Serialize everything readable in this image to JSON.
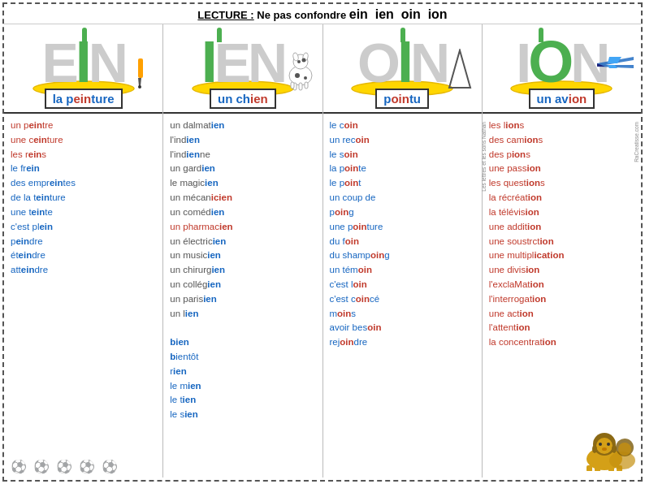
{
  "title": {
    "prefix": "LECTURE : Ne pas confondre ",
    "sounds": "ein  ien  oin  ion"
  },
  "columns": [
    {
      "id": "ein",
      "bigLetter1": "E",
      "bigLetter2": "N",
      "greenLetter": "I",
      "wordLabel": "la peinture",
      "wordLabelHighlight": "ein",
      "words": [
        {
          "text": "un peintre",
          "color": "red",
          "bold": "ein"
        },
        {
          "text": "une ceinture",
          "color": "red",
          "bold": "ein"
        },
        {
          "text": "les reins",
          "color": "red",
          "bold": "ein"
        },
        {
          "text": "le frein",
          "color": "blue",
          "bold": "ein"
        },
        {
          "text": "des empreintes",
          "color": "blue",
          "bold": "ein"
        },
        {
          "text": "de la teinture",
          "color": "blue",
          "bold": "ein"
        },
        {
          "text": "une teinte",
          "color": "blue",
          "bold": "ein"
        },
        {
          "text": "c'est plein",
          "color": "blue",
          "bold": "ein"
        },
        {
          "text": "peindre",
          "color": "blue",
          "bold": "ein"
        },
        {
          "text": "éteindre",
          "color": "blue",
          "bold": "ein"
        },
        {
          "text": "atteindre",
          "color": "blue",
          "bold": "ein"
        }
      ],
      "hasFooterIcons": true
    },
    {
      "id": "ien",
      "bigLetter1": "E",
      "bigLetter2": "N",
      "greenLetter": "I",
      "wordLabel": "un chien",
      "wordLabelHighlight": "ien",
      "words": [
        {
          "text": "un dalmatien",
          "color": "dark"
        },
        {
          "text": "l'indien",
          "color": "dark"
        },
        {
          "text": "l'indienne",
          "color": "dark"
        },
        {
          "text": "un gardien",
          "color": "dark"
        },
        {
          "text": "le magicien",
          "color": "dark"
        },
        {
          "text": "un mécanicien",
          "color": "dark"
        },
        {
          "text": "un comédien",
          "color": "dark"
        },
        {
          "text": "un pharmacien",
          "color": "dark"
        },
        {
          "text": "un électricien",
          "color": "dark"
        },
        {
          "text": "un musicien",
          "color": "dark"
        },
        {
          "text": "un chirurgien",
          "color": "dark"
        },
        {
          "text": "un collégien",
          "color": "dark"
        },
        {
          "text": "un parisien",
          "color": "dark"
        },
        {
          "text": "un lien",
          "color": "dark"
        },
        {
          "text": "",
          "color": "dark"
        },
        {
          "text": "bien",
          "color": "blue",
          "bold": "ien"
        },
        {
          "text": "bientôt",
          "color": "blue",
          "bold": "ien"
        },
        {
          "text": "rien",
          "color": "blue",
          "bold": "ien"
        },
        {
          "text": "le mien",
          "color": "blue",
          "bold": "ien"
        },
        {
          "text": "le tien",
          "color": "blue",
          "bold": "ien"
        },
        {
          "text": "le sien",
          "color": "blue",
          "bold": "ien"
        }
      ],
      "hasFooterIcons": false
    },
    {
      "id": "oin",
      "bigLetter1": "O",
      "bigLetter2": "N",
      "greenLetter": "I",
      "wordLabel": "pointu",
      "wordLabelHighlight": "oin",
      "words": [
        {
          "text": "le coin",
          "color": "blue",
          "bold": "oin"
        },
        {
          "text": "un recoin",
          "color": "blue",
          "bold": "oin"
        },
        {
          "text": "le soin",
          "color": "blue",
          "bold": "oin"
        },
        {
          "text": "la pointe",
          "color": "blue",
          "bold": "oin"
        },
        {
          "text": "le point",
          "color": "blue",
          "bold": "oin"
        },
        {
          "text": "un coup de",
          "color": "blue"
        },
        {
          "text": "poing",
          "color": "blue",
          "bold": "oing"
        },
        {
          "text": "une pointure",
          "color": "blue",
          "bold": "oin"
        },
        {
          "text": "du foin",
          "color": "blue",
          "bold": "oin"
        },
        {
          "text": "du shampoing",
          "color": "blue",
          "bold": "oin"
        },
        {
          "text": "un témoin",
          "color": "blue",
          "bold": "oin"
        },
        {
          "text": "c'est loin",
          "color": "blue",
          "bold": "oin"
        },
        {
          "text": "c'est coincé",
          "color": "blue",
          "bold": "oin"
        },
        {
          "text": "moins",
          "color": "blue",
          "bold": "oin"
        },
        {
          "text": "avoir besoin",
          "color": "blue",
          "bold": "oin"
        },
        {
          "text": "rejoindre",
          "color": "blue",
          "bold": "oin"
        }
      ],
      "hasFooterIcons": false
    },
    {
      "id": "ion",
      "bigLetter1": "O",
      "bigLetter2": "N",
      "greenLetter": "I",
      "wordLabel": "un avion",
      "wordLabelHighlight": "ion",
      "words": [
        {
          "text": "les lions",
          "color": "red",
          "bold": "ion"
        },
        {
          "text": "des camions",
          "color": "red",
          "bold": "ion"
        },
        {
          "text": "des pions",
          "color": "red",
          "bold": "ion"
        },
        {
          "text": "une passion",
          "color": "red",
          "bold": "ion"
        },
        {
          "text": "les questions",
          "color": "red",
          "bold": "ion"
        },
        {
          "text": "la récréation",
          "color": "red",
          "bold": "ion"
        },
        {
          "text": "la télévision",
          "color": "red",
          "bold": "ion"
        },
        {
          "text": "une addition",
          "color": "red",
          "bold": "ion"
        },
        {
          "text": "une soustraction",
          "color": "red",
          "bold": "ion"
        },
        {
          "text": "une multiplication",
          "color": "red",
          "bold": "ion"
        },
        {
          "text": "une division",
          "color": "red",
          "bold": "ion"
        },
        {
          "text": "l'exclamation",
          "color": "red",
          "bold": "ion"
        },
        {
          "text": "l'interrogation",
          "color": "red",
          "bold": "ion"
        },
        {
          "text": "une action",
          "color": "red",
          "bold": "ion"
        },
        {
          "text": "l'attention",
          "color": "red",
          "bold": "ion"
        },
        {
          "text": "la concentration",
          "color": "red",
          "bold": "ion"
        }
      ],
      "hasFooterIcons": false,
      "hasLion": true
    }
  ],
  "watermark": "RaCreatisse.com",
  "credits": "Les lettres et les sons Nathan",
  "footer": {
    "soccer_balls": [
      "⚽",
      "⚽",
      "⚽",
      "⚽",
      "⚽"
    ]
  }
}
